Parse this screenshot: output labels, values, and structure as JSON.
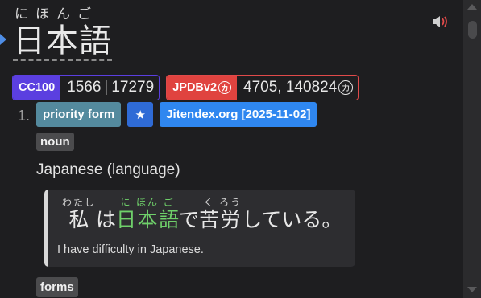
{
  "headword": {
    "reading": "にほんご",
    "term": "日本語"
  },
  "icons": {
    "audio": "speaker-volume-icon",
    "marker": "triangle-marker-icon",
    "star": "star-icon"
  },
  "frequencies": [
    {
      "dictionary": "CC100",
      "dictionary_circle": "",
      "value": "1566",
      "value2": "17279",
      "color": "#5b3fe0"
    },
    {
      "dictionary": "JPDBv2",
      "dictionary_circle": "カ",
      "value": "4705, 140824",
      "value_circle": "カ",
      "color": "#e0433f"
    }
  ],
  "definition": {
    "number": "1.",
    "tags": {
      "priority": "priority form",
      "star": "★",
      "dictionary": "Jitendex.org [2025-11-02]"
    },
    "part_of_speech": "noun",
    "gloss": "Japanese (language)",
    "example": {
      "segments": [
        {
          "text": "私",
          "reading": "わたし",
          "highlight": false
        },
        {
          "text": "は",
          "reading": "",
          "highlight": false
        },
        {
          "text": "日",
          "reading": "に",
          "highlight": true
        },
        {
          "text": "本",
          "reading": "ほん",
          "highlight": true
        },
        {
          "text": "語",
          "reading": "ご",
          "highlight": true
        },
        {
          "text": "で",
          "reading": "",
          "highlight": false
        },
        {
          "text": "苦",
          "reading": "く",
          "highlight": false
        },
        {
          "text": "労",
          "reading": "ろう",
          "highlight": false
        },
        {
          "text": "している。",
          "reading": "",
          "highlight": false
        }
      ],
      "translation": "I have difficulty in Japanese."
    }
  },
  "sections": {
    "forms": "forms"
  },
  "colors": {
    "background": "#1e1e20",
    "cc100": "#5b3fe0",
    "jpdb": "#e0433f",
    "priority": "#548a9e",
    "dictionary_tag": "#2f87f0",
    "highlight": "#6fd06a"
  }
}
